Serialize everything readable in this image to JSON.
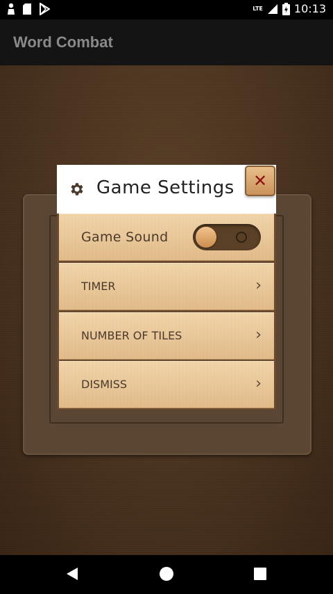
{
  "status_bar": {
    "time": "10:13",
    "network": "LTE",
    "left_icons": [
      "notification-icon",
      "sd-card-icon",
      "play-store-icon"
    ],
    "right_icons": [
      "signal-icon",
      "battery-icon"
    ]
  },
  "app_bar": {
    "title": "Word Combat"
  },
  "dialog": {
    "title": "Game Settings",
    "close_label": "✕",
    "rows": [
      {
        "label": "Game Sound",
        "control": "toggle",
        "toggle_on": false
      },
      {
        "label": "TIMER",
        "chevron": "›"
      },
      {
        "label": "NUMBER OF TILES",
        "chevron": "›"
      },
      {
        "label": "DISMISS",
        "chevron": "›"
      }
    ]
  },
  "colors": {
    "wood_dark": "#4a3320",
    "row_light": "#f0d3a8",
    "close_x": "#8f1010",
    "toggle_track": "#5a4026"
  },
  "nav_bar": {
    "icons": [
      "back-icon",
      "home-icon",
      "recents-icon"
    ]
  }
}
